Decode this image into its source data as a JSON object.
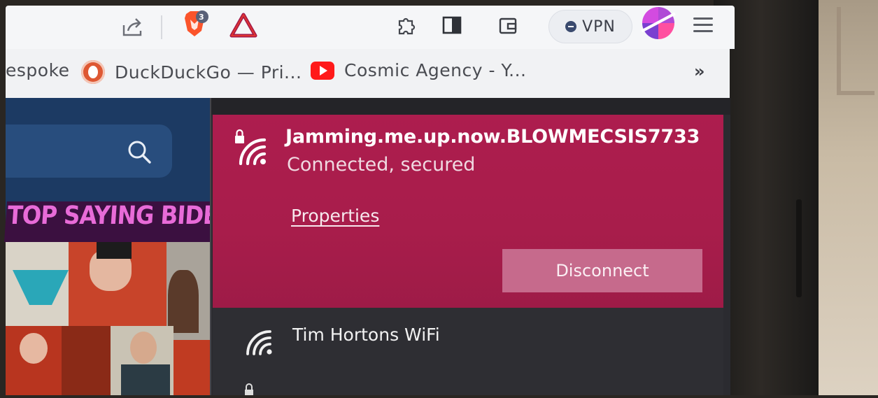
{
  "toolbar": {
    "brave_badge_count": "3",
    "vpn_label": "VPN"
  },
  "bookmarks": {
    "items": [
      {
        "label": "espoke"
      },
      {
        "label": "DuckDuckGo — Pri..."
      },
      {
        "label": "Cosmic Agency - Y..."
      }
    ],
    "more_label": "»"
  },
  "page": {
    "banner_text": "TOP SAYING BIDEN!"
  },
  "wifi": {
    "connected_network": {
      "ssid": "Jamming.me.up.now.BLOWMECSIS7733",
      "status": "Connected, secured",
      "properties_label": "Properties",
      "disconnect_label": "Disconnect"
    },
    "networks": [
      {
        "name": "Tim Hortons WiFi"
      }
    ]
  },
  "colors": {
    "connected_bg": "#ad1d4e",
    "flyout_bg": "#2b2b30",
    "disconnect_bg": "#c66a8c",
    "toolbar_bg": "#f5f6f8"
  }
}
